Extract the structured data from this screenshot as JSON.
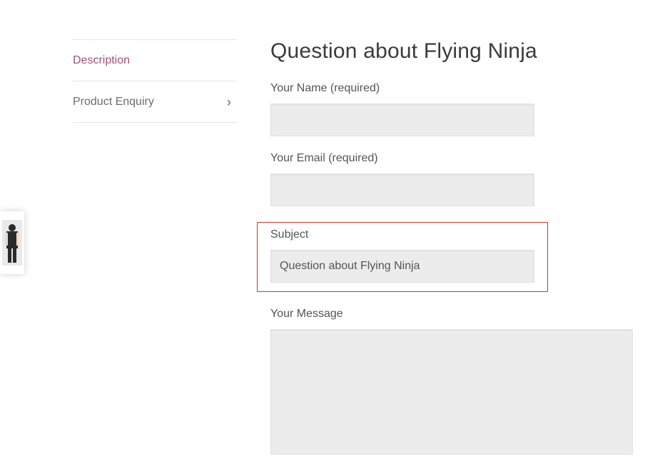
{
  "sidebar": {
    "tabs": [
      {
        "label": "Description"
      },
      {
        "label": "Product Enquiry"
      }
    ]
  },
  "form": {
    "heading": "Question about Flying Ninja",
    "name_label": "Your Name (required)",
    "name_value": "",
    "email_label": "Your Email (required)",
    "email_value": "",
    "subject_label": "Subject",
    "subject_value": "Question about Flying Ninja",
    "message_label": "Your Message",
    "message_value": ""
  }
}
